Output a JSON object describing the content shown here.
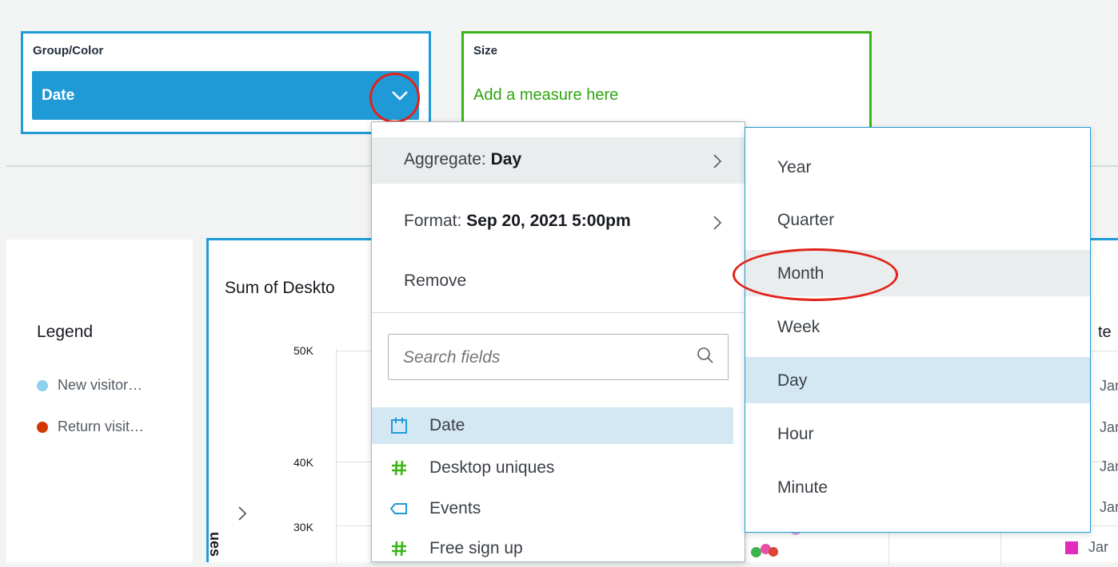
{
  "wells": {
    "group_color": {
      "title": "Group/Color",
      "field": "Date"
    },
    "size": {
      "title": "Size",
      "placeholder": "Add a measure here"
    }
  },
  "legend": {
    "title": "Legend",
    "items": [
      {
        "label": "New visitor…",
        "color": "#8ed0ef"
      },
      {
        "label": "Return visit…",
        "color": "#d53600"
      }
    ]
  },
  "chart": {
    "title_clipped": "Sum of Deskto",
    "y_ticks": [
      "50K",
      "40K",
      "30K"
    ],
    "y_axis_label_clipped": "ues",
    "right_clipped_title": "te",
    "right_labels": [
      "Jar",
      "Jar",
      "Jar",
      "Jar",
      "Jar"
    ]
  },
  "field_menu": {
    "aggregate_prefix": "Aggregate: ",
    "aggregate_value": "Day",
    "format_prefix": "Format: ",
    "format_value": "Sep 20, 2021 5:00pm",
    "remove_label": "Remove",
    "search_placeholder": "Search fields",
    "fields": [
      {
        "name": "Date",
        "icon": "calendar-icon"
      },
      {
        "name": "Desktop uniques",
        "icon": "hash-icon"
      },
      {
        "name": "Events",
        "icon": "tag-icon"
      },
      {
        "name": "Free sign up",
        "icon": "hash-icon"
      }
    ]
  },
  "aggregate_submenu": {
    "options": [
      "Year",
      "Quarter",
      "Month",
      "Week",
      "Day",
      "Hour",
      "Minute"
    ],
    "highlighted": "Month",
    "selected": "Day"
  },
  "colors": {
    "accent": "#1f9bd7",
    "pill": "#209ad6",
    "measure_green": "#3ab518",
    "annotation_red": "#e2231a"
  }
}
